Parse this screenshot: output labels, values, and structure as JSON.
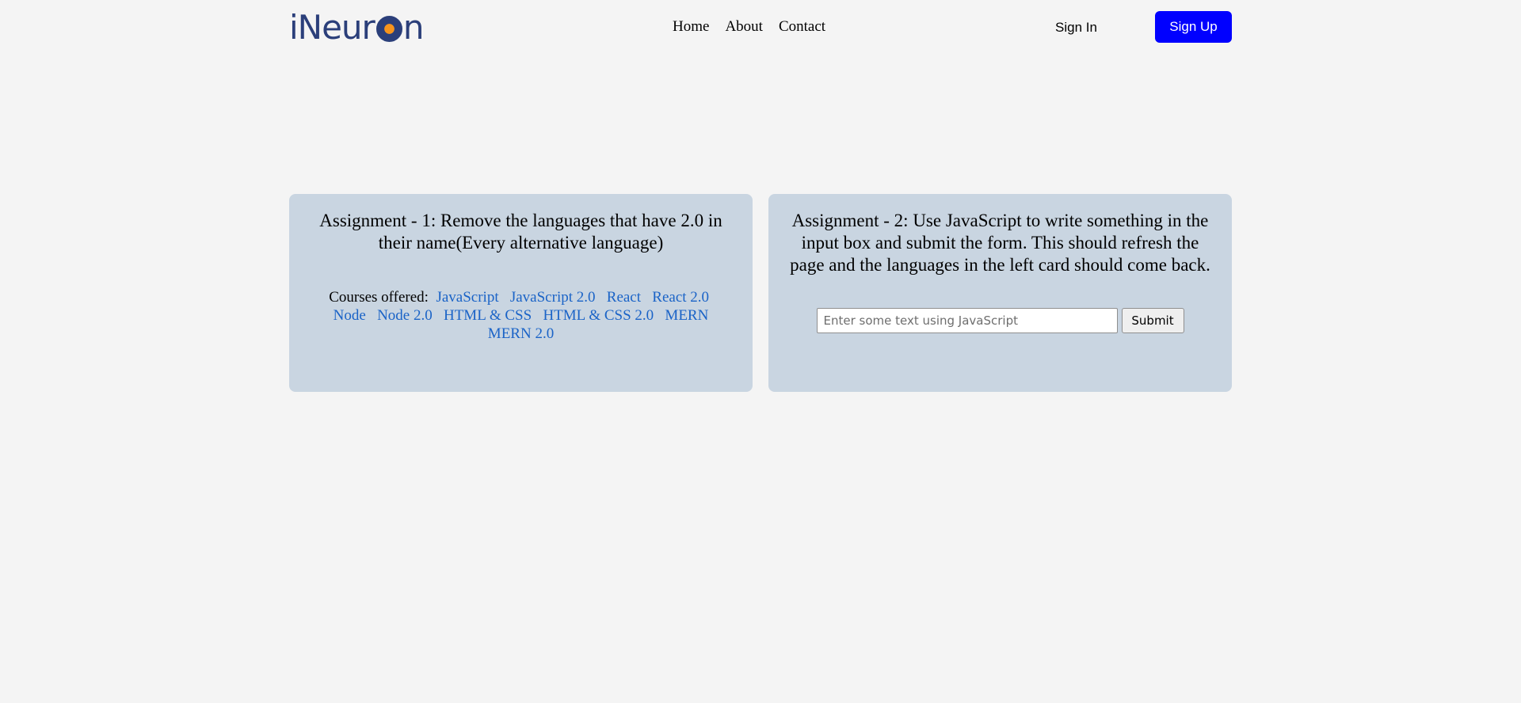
{
  "header": {
    "logo": {
      "prefix": "iNeur",
      "suffix": "n"
    },
    "nav": [
      "Home",
      "About",
      "Contact"
    ],
    "sign_in": "Sign In",
    "sign_up": "Sign Up"
  },
  "assignment1": {
    "title": "Assignment - 1: Remove the languages that have 2.0 in their name(Every alternative language)",
    "courses_label": "Courses offered:",
    "courses": [
      "JavaScript",
      "JavaScript 2.0",
      "React",
      "React 2.0",
      "Node",
      "Node 2.0",
      "HTML & CSS",
      "HTML & CSS 2.0",
      "MERN",
      "MERN 2.0"
    ]
  },
  "assignment2": {
    "title": "Assignment - 2: Use JavaScript to write something in the input box and submit the form. This should refresh the page and the languages in the left card should come back.",
    "input_placeholder": "Enter some text using JavaScript",
    "input_value": "",
    "submit_label": "Submit"
  },
  "colors": {
    "background": "#f4f4f4",
    "card": "#c9d5e1",
    "sign_up_button": "#0000ff",
    "link": "#1a63c7",
    "logo_blue": "#2b3f7a",
    "logo_orange": "#f7941d"
  }
}
